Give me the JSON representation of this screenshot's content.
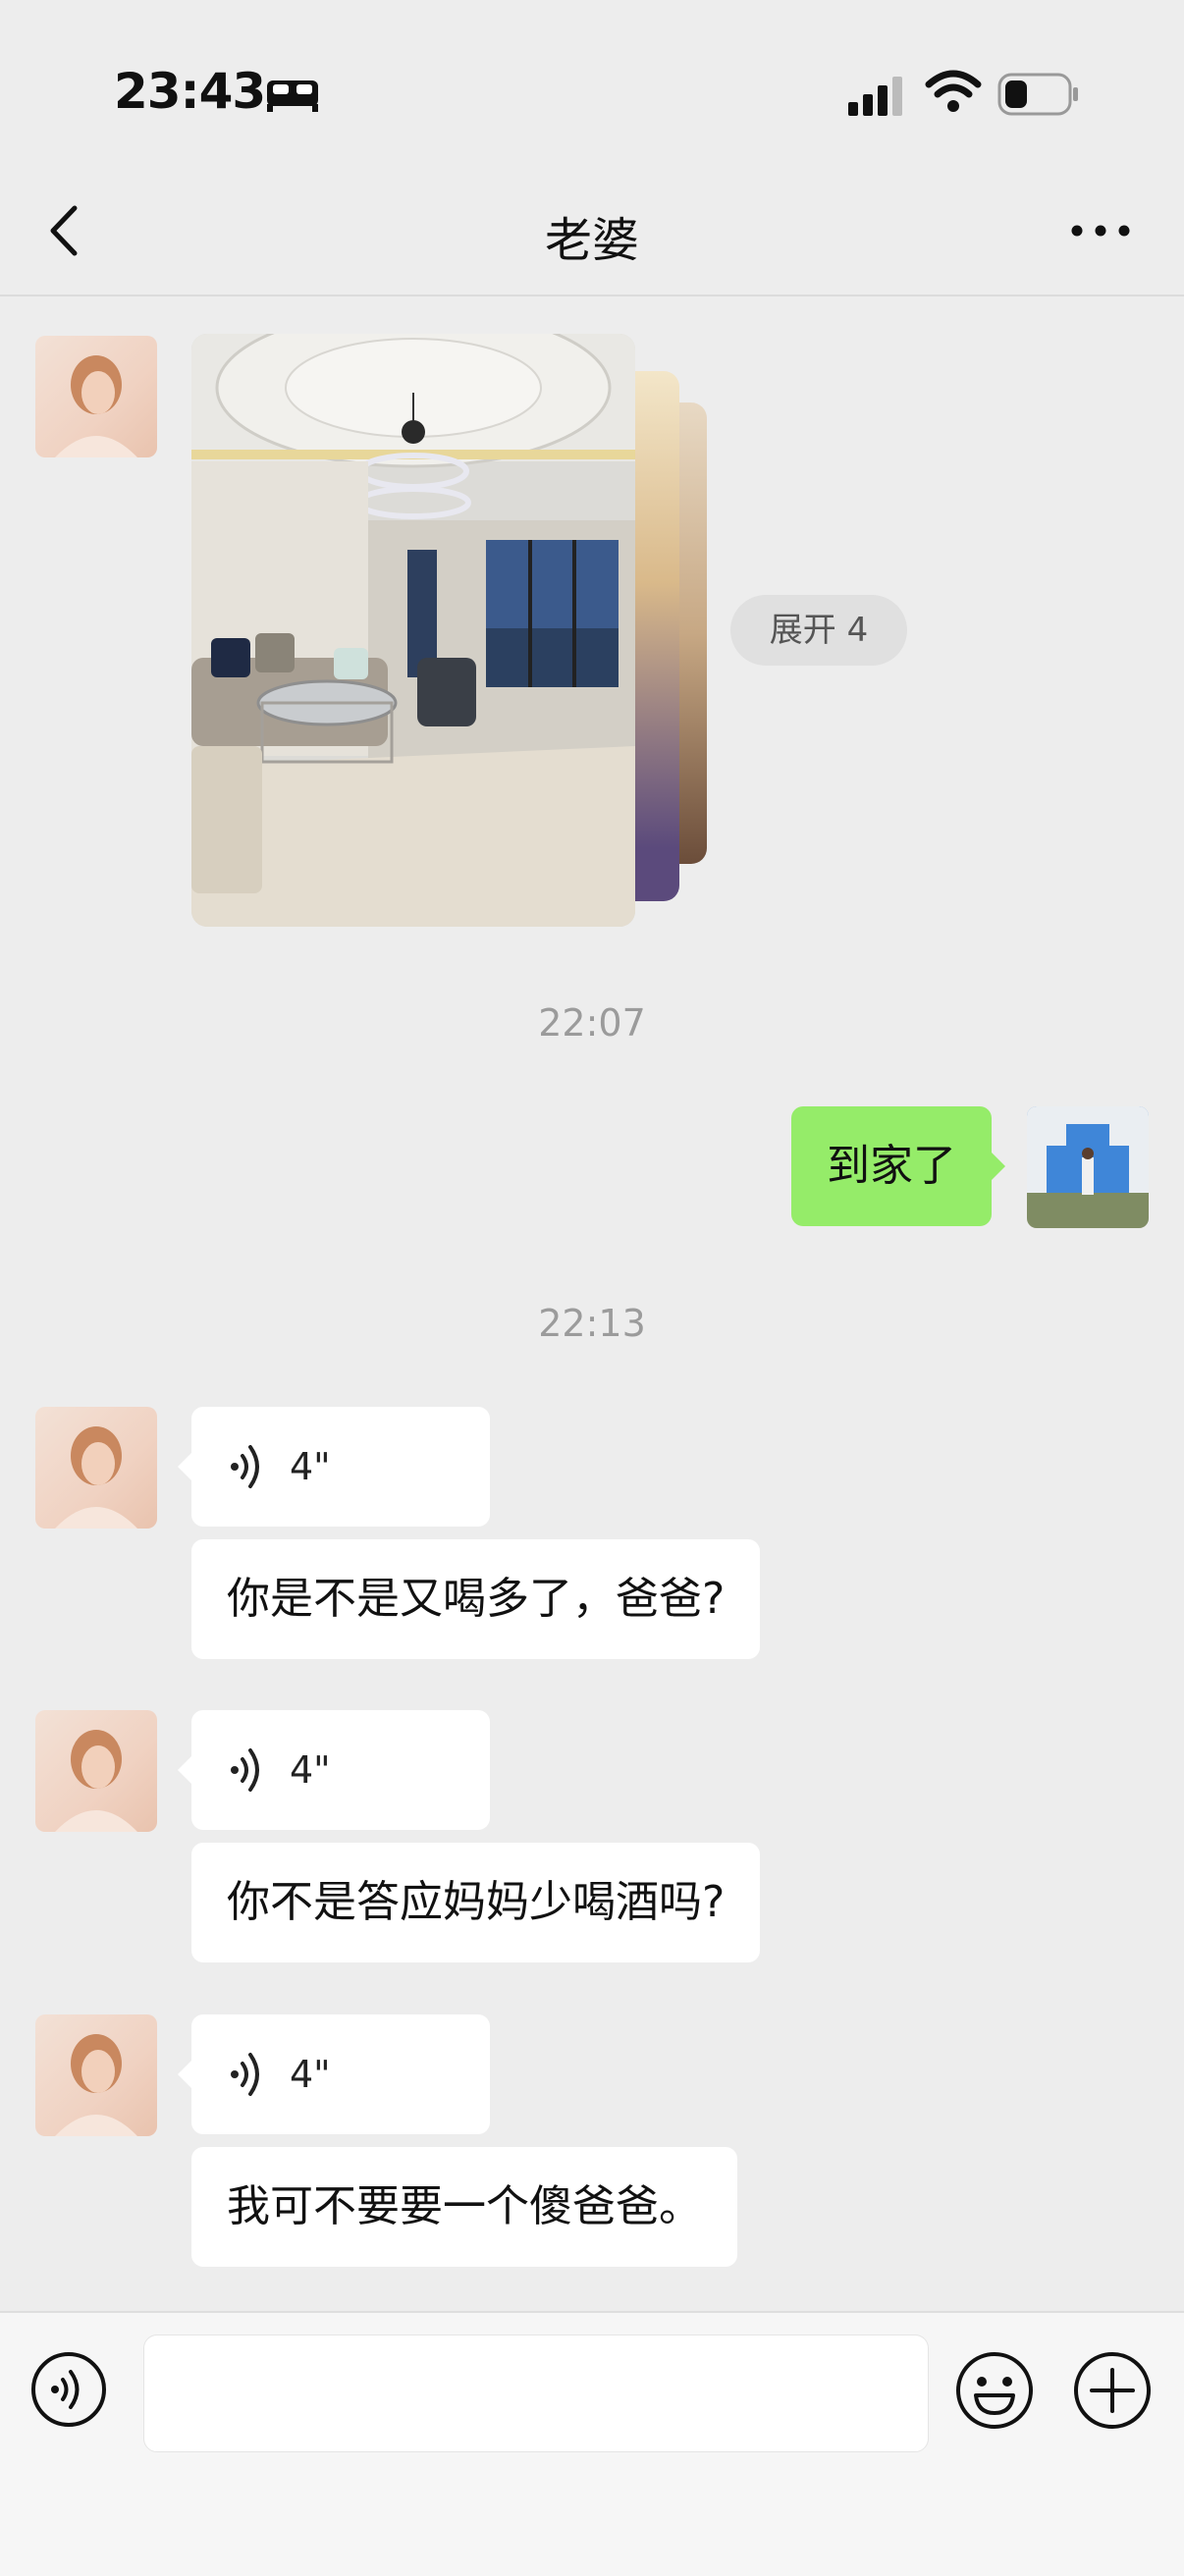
{
  "status_bar": {
    "time": "23:43",
    "sleep_icon": "bed-icon",
    "signal_icon": "cellular-signal-icon",
    "wifi_icon": "wifi-icon",
    "battery_icon": "battery-icon"
  },
  "nav": {
    "title": "老婆",
    "back_icon": "chevron-left-icon",
    "more_icon": "more-dots-icon"
  },
  "messages": {
    "photo_group": {
      "expand_label": "展开 4"
    },
    "timestamp_1": "22:07",
    "sent_text": "到家了",
    "timestamp_2": "22:13",
    "groups": [
      {
        "voice_duration": "4\"",
        "text": "你是不是又喝多了，爸爸?"
      },
      {
        "voice_duration": "4\"",
        "text": "你不是答应妈妈少喝酒吗?"
      },
      {
        "voice_duration": "4\"",
        "text": "我可不要要一个傻爸爸。"
      }
    ]
  },
  "input_bar": {
    "voice_icon": "voice-toggle-icon",
    "emoji_icon": "emoji-icon",
    "plus_icon": "plus-circle-icon",
    "input_value": ""
  },
  "colors": {
    "background": "#ededed",
    "sent_bubble": "#95ec69",
    "received_bubble": "#ffffff"
  }
}
